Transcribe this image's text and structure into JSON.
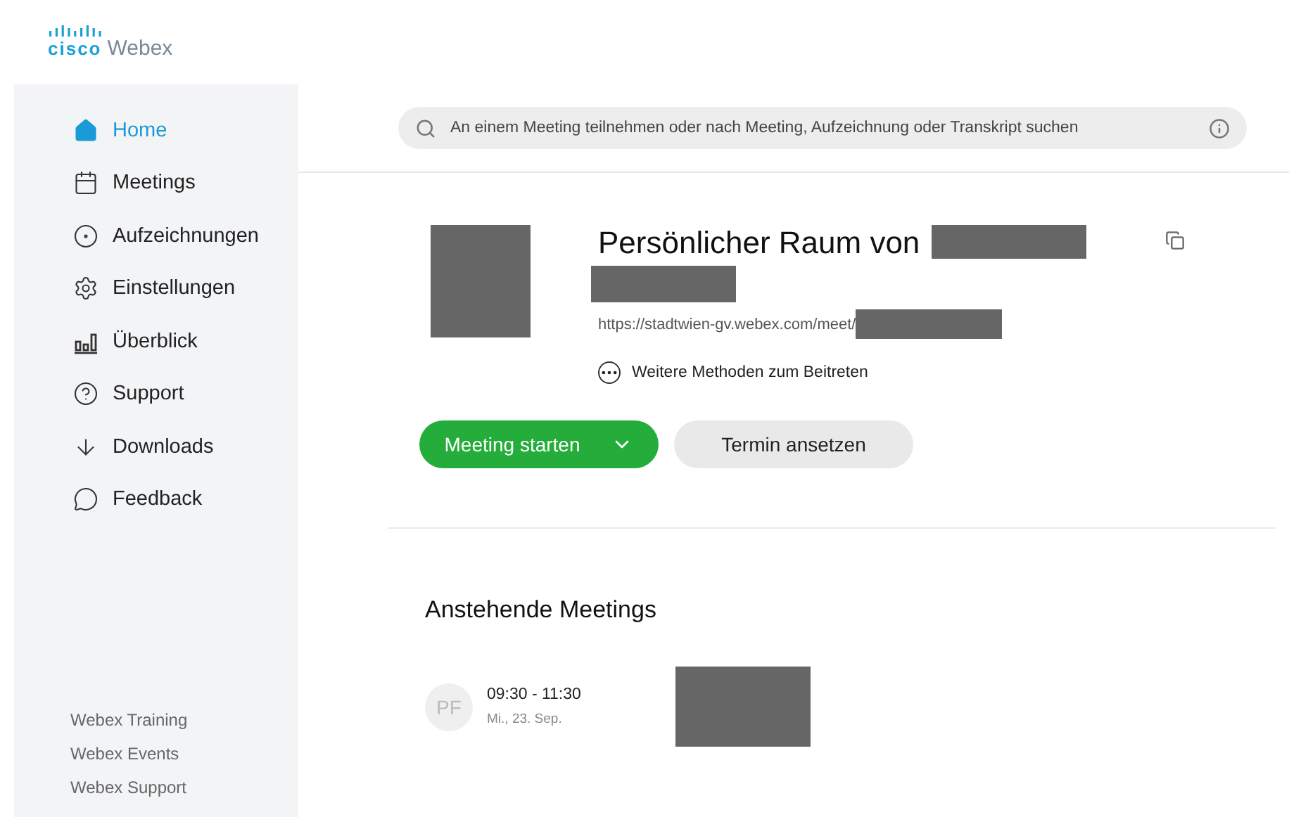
{
  "logo": {
    "brand": "cisco",
    "product": "Webex"
  },
  "sidebar": {
    "items": [
      {
        "label": "Home",
        "selected": true
      },
      {
        "label": "Meetings",
        "selected": false
      },
      {
        "label": "Aufzeichnungen",
        "selected": false
      },
      {
        "label": "Einstellungen",
        "selected": false
      },
      {
        "label": "Überblick",
        "selected": false
      },
      {
        "label": "Support",
        "selected": false
      },
      {
        "label": "Downloads",
        "selected": false
      },
      {
        "label": "Feedback",
        "selected": false
      }
    ],
    "footer_links": [
      "Webex Training",
      "Webex Events",
      "Webex Support"
    ]
  },
  "search": {
    "placeholder": "An einem Meeting teilnehmen oder nach Meeting, Aufzeichnung oder Transkript suchen"
  },
  "room": {
    "title": "Persönlicher Raum von",
    "url": "https://stadtwien-gv.webex.com/meet/",
    "more_methods": "Weitere Methoden zum Beitreten"
  },
  "buttons": {
    "start": "Meeting starten",
    "schedule": "Termin ansetzen"
  },
  "upcoming": {
    "heading": "Anstehende Meetings",
    "meetings": [
      {
        "initials": "PF",
        "time": "09:30 - 11:30",
        "date": "Mi., 23. Sep."
      }
    ]
  }
}
